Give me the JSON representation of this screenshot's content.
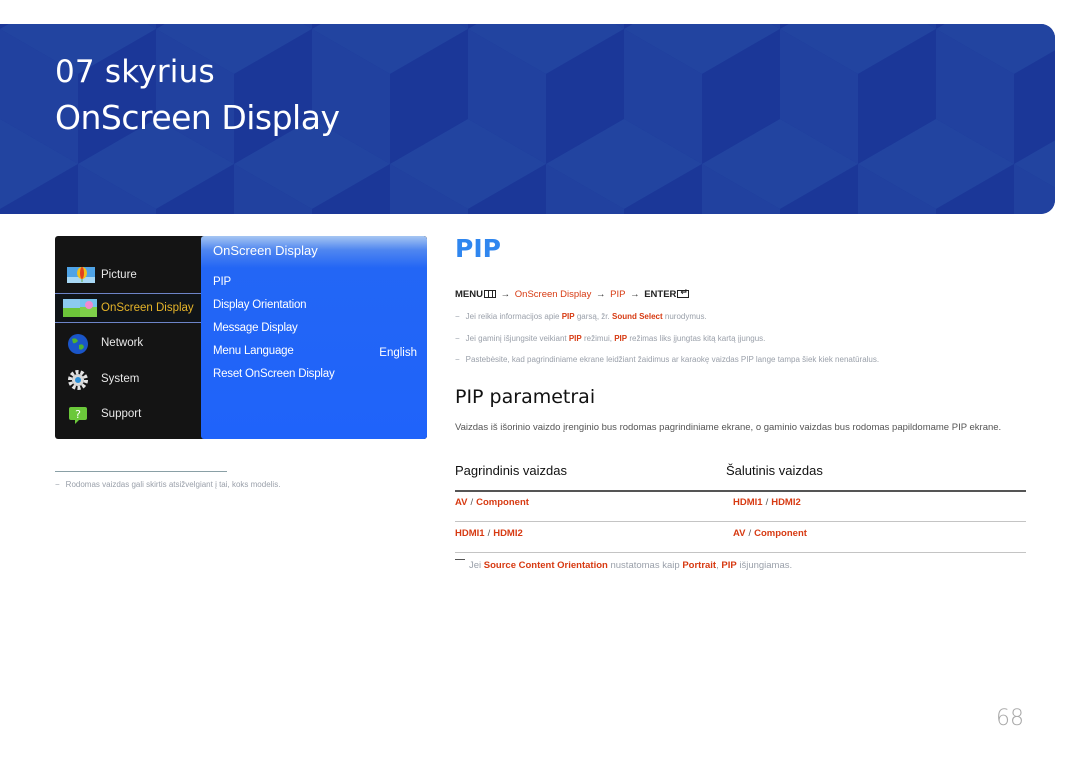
{
  "banner": {
    "chapter": "07 skyrius",
    "title": "OnScreen Display",
    "color": "#1f3d9e"
  },
  "menu": {
    "left_items": [
      {
        "label": "Picture",
        "icon": "picture-icon",
        "selected": false
      },
      {
        "label": "OnScreen Display",
        "icon": "onscreen-display-icon",
        "selected": true
      },
      {
        "label": "Network",
        "icon": "globe-icon",
        "selected": false
      },
      {
        "label": "System",
        "icon": "gear-icon",
        "selected": false
      },
      {
        "label": "Support",
        "icon": "help-bubble-icon",
        "selected": false
      }
    ],
    "submenu": {
      "title": "OnScreen Display",
      "items": [
        {
          "label": "PIP",
          "value": ""
        },
        {
          "label": "Display Orientation",
          "value": ""
        },
        {
          "label": "Message Display",
          "value": ""
        },
        {
          "label": "Menu Language",
          "value": "English"
        },
        {
          "label": "Reset OnScreen Display",
          "value": ""
        }
      ]
    },
    "selected_color": "#e6b429"
  },
  "left_footnote": {
    "dash": "−",
    "text": "Rodomas vaizdas gali skirtis atsižvelgiant į tai, koks modelis."
  },
  "section": {
    "heading": "PIP",
    "heading_color": "#2f86ef",
    "menu_path": {
      "menu": "MENU",
      "arrow": "→",
      "step1": "OnScreen Display",
      "step2": "PIP",
      "enter": "ENTER"
    },
    "notes": [
      {
        "dash": "−",
        "parts": [
          "Jei reikia informacijos apie ",
          "PIP",
          " garsą, žr. ",
          "Sound Select",
          " nurodymus."
        ]
      },
      {
        "dash": "−",
        "parts": [
          "Jei gaminį išjungsite veikiant ",
          "PIP",
          " režimui, ",
          "PIP",
          " režimas liks įjungtas kitą kartą įjungus."
        ]
      },
      {
        "dash": "−",
        "parts": [
          "Pastebėsite, kad pagrindiniame ekrane leidžiant žaidimus ar karaokę vaizdas PIP lange tampa šiek kiek nenatūralus."
        ]
      }
    ],
    "accent_color": "#d73a12"
  },
  "params": {
    "heading": "PIP parametrai",
    "description": "Vaizdas iš išorinio vaizdo įrenginio bus rodomas pagrindiniame ekrane, o gaminio vaizdas bus rodomas papildomame PIP ekrane.",
    "columns": [
      "Pagrindinis vaizdas",
      "Šalutinis vaizdas"
    ],
    "rows": [
      {
        "main": [
          "AV",
          "Component"
        ],
        "sub": [
          "HDMI1",
          "HDMI2"
        ]
      },
      {
        "main": [
          "HDMI1",
          "HDMI2"
        ],
        "sub": [
          "AV",
          "Component"
        ]
      }
    ],
    "separator": "/",
    "note_parts": [
      "Jei ",
      "Source Content Orientation",
      " nustatomas kaip ",
      "Portrait",
      ", ",
      "PIP",
      " išjungiamas."
    ]
  },
  "page_number": "68"
}
